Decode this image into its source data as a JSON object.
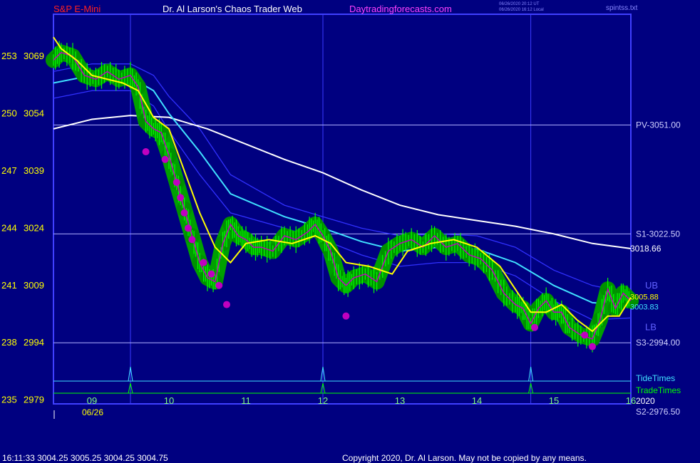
{
  "header": {
    "instrument": "S&P E-Mini",
    "title": "Dr. Al Larson's Chaos Trader Web",
    "site": "Daytradingforecasts.com",
    "stamp_ut": "06/26/2020 20:12 UT",
    "stamp_local": "06/26/2020 16:12 Local",
    "file": "spintss.txt"
  },
  "footer": {
    "quote": "16:11:33  3004.25 3005.25 3004.25 3004.75",
    "copyright": "Copyright 2020, Dr. Al Larson. May not be copied by any means."
  },
  "colors": {
    "background": "#000080",
    "frame": "#4040ff",
    "price_fill": "#00a000",
    "price_bar": "#00ff00",
    "magenta": "#c000c0",
    "yellow": "#ffff00",
    "cyan": "#40e0ff",
    "white": "#ffffff",
    "blue_band": "#3030ff",
    "red_text": "#ff2020",
    "magenta_text": "#ff40ff"
  },
  "chart_data": {
    "type": "line",
    "date_label": "06/26",
    "year_label": "2020",
    "xlim": [
      8.5,
      16.0
    ],
    "ylim": [
      2978,
      3080
    ],
    "x_ticks": [
      {
        "x": 9,
        "label": "09"
      },
      {
        "x": 10,
        "label": "10"
      },
      {
        "x": 11,
        "label": "11"
      },
      {
        "x": 12,
        "label": "12"
      },
      {
        "x": 13,
        "label": "13"
      },
      {
        "x": 14,
        "label": "14"
      },
      {
        "x": 15,
        "label": "15"
      },
      {
        "x": 16,
        "label": "16"
      }
    ],
    "y_ticks": [
      {
        "y": 3069,
        "left": "253",
        "right": "3069"
      },
      {
        "y": 3054,
        "left": "250",
        "right": "3054"
      },
      {
        "y": 3039,
        "left": "247",
        "right": "3039"
      },
      {
        "y": 3024,
        "left": "244",
        "right": "3024"
      },
      {
        "y": 3009,
        "left": "241",
        "right": "3009"
      },
      {
        "y": 2994,
        "left": "238",
        "right": "2994"
      },
      {
        "y": 2979,
        "left": "235",
        "right": "2979"
      }
    ],
    "levels": [
      {
        "label": "PV-3051.00",
        "value": 3051.0
      },
      {
        "label": "S1-3022.50",
        "value": 3022.5
      },
      {
        "label": "S3-2994.00",
        "value": 2994.0
      },
      {
        "label": "S2-2976.50",
        "value": 2976.5
      }
    ],
    "tide_times": {
      "label": "TideTimes",
      "x": [
        9.5,
        12.0,
        14.7
      ]
    },
    "trade_times": {
      "label": "TradeTimes",
      "x": [
        9.5,
        12.0,
        14.7
      ]
    },
    "band_labels": {
      "upper": "UB",
      "lower": "LB"
    },
    "end_labels": {
      "white": "3018.66",
      "yellow": "3005.88",
      "cyan": "3003.83"
    },
    "series": [
      {
        "x": [
          8.5,
          9.0,
          9.5,
          10.0,
          10.5,
          11.0,
          11.5,
          12.0,
          12.5,
          13.0,
          13.5,
          14.0,
          14.5,
          15.0,
          15.5,
          16.0
        ],
        "y": [
          3050.0,
          3052.5,
          3053.5,
          3053.0,
          3050.0,
          3046.0,
          3042.0,
          3038.5,
          3034.0,
          3030.0,
          3027.5,
          3026.0,
          3024.5,
          3022.5,
          3020.0,
          3018.66
        ]
      },
      {
        "x": [
          8.5,
          9.0,
          9.5,
          9.8,
          10.0,
          10.4,
          10.8,
          11.5,
          12.0,
          12.5,
          13.0,
          13.5,
          14.0,
          14.5,
          15.0,
          15.5,
          16.0
        ],
        "y": [
          3062.0,
          3064.0,
          3063.5,
          3060.0,
          3054.0,
          3044.0,
          3033.0,
          3027.0,
          3024.0,
          3020.5,
          3018.0,
          3019.0,
          3018.5,
          3015.0,
          3009.0,
          3004.5,
          3003.83
        ]
      },
      {
        "x": [
          8.5,
          9.0,
          9.5,
          9.8,
          10.0,
          10.4,
          10.8,
          11.5,
          12.0,
          12.5,
          13.0,
          13.5,
          14.0,
          14.5,
          15.0,
          15.5,
          16.0
        ],
        "y": [
          3065.0,
          3067.0,
          3067.0,
          3064.0,
          3058.5,
          3050.0,
          3038.0,
          3030.0,
          3027.0,
          3024.0,
          3022.0,
          3022.5,
          3022.0,
          3019.0,
          3013.0,
          3009.0,
          3007.0
        ]
      },
      {
        "x": [
          8.5,
          9.0,
          9.5,
          9.8,
          10.0,
          10.4,
          10.8,
          11.5,
          12.0,
          12.5,
          13.0,
          13.5,
          14.0,
          14.5,
          15.0,
          15.5,
          16.0
        ],
        "y": [
          3058.0,
          3060.0,
          3060.0,
          3056.0,
          3049.5,
          3038.0,
          3028.0,
          3024.0,
          3021.0,
          3017.0,
          3014.0,
          3015.0,
          3015.0,
          3011.5,
          3005.0,
          3000.0,
          3000.5
        ]
      },
      {
        "x": [
          8.5,
          8.6,
          8.8,
          9.0,
          9.2,
          9.4,
          9.6,
          9.8,
          10.0,
          10.2,
          10.4,
          10.6,
          10.8,
          11.0,
          11.3,
          11.6,
          11.9,
          12.1,
          12.3,
          12.6,
          12.9,
          13.1,
          13.4,
          13.7,
          14.0,
          14.3,
          14.5,
          14.7,
          14.9,
          15.1,
          15.3,
          15.5,
          15.7,
          15.85,
          16.0
        ],
        "y": [
          3074.0,
          3071.0,
          3068.0,
          3064.0,
          3063.0,
          3062.0,
          3060.0,
          3053.0,
          3050.0,
          3039.0,
          3028.0,
          3019.0,
          3015.0,
          3020.0,
          3021.0,
          3020.0,
          3022.0,
          3020.0,
          3015.0,
          3014.0,
          3012.0,
          3018.0,
          3020.0,
          3021.0,
          3019.0,
          3014.0,
          3008.0,
          3002.0,
          3002.0,
          3004.0,
          3000.0,
          2997.0,
          3001.0,
          3001.0,
          3005.88
        ]
      }
    ],
    "price_path": {
      "x": [
        8.5,
        8.6,
        8.75,
        8.9,
        9.05,
        9.2,
        9.35,
        9.5,
        9.6,
        9.7,
        9.8,
        9.9,
        10.0,
        10.1,
        10.2,
        10.3,
        10.4,
        10.5,
        10.6,
        10.7,
        10.8,
        10.9,
        11.0,
        11.1,
        11.2,
        11.35,
        11.5,
        11.65,
        11.8,
        11.9,
        12.0,
        12.1,
        12.2,
        12.3,
        12.4,
        12.55,
        12.7,
        12.85,
        13.0,
        13.15,
        13.3,
        13.45,
        13.6,
        13.75,
        13.9,
        14.05,
        14.2,
        14.35,
        14.5,
        14.6,
        14.7,
        14.8,
        14.9,
        15.0,
        15.1,
        15.2,
        15.35,
        15.5,
        15.6,
        15.7,
        15.8,
        15.9,
        16.0
      ],
      "y": [
        3068,
        3070,
        3069,
        3064,
        3063,
        3065,
        3063,
        3064,
        3061,
        3052,
        3050,
        3049,
        3043,
        3036,
        3029,
        3022,
        3015,
        3011,
        3010,
        3020,
        3025,
        3022,
        3021,
        3019,
        3019,
        3018,
        3022,
        3021,
        3023,
        3025,
        3022,
        3018,
        3011,
        3009,
        3011,
        3012,
        3010,
        3018,
        3020,
        3021,
        3019,
        3022,
        3019,
        3020,
        3017,
        3016,
        3013,
        3007,
        3004,
        3003,
        2999,
        3003,
        3005,
        3002,
        3002,
        2998,
        2996,
        2995,
        3000,
        3008,
        3003,
        3007,
        3005
      ]
    },
    "magenta_dots": {
      "x": [
        9.7,
        9.95,
        10.1,
        10.15,
        10.2,
        10.25,
        10.3,
        10.45,
        10.55,
        10.65,
        10.75,
        12.3,
        14.75,
        15.4,
        15.5
      ],
      "y": [
        3044,
        3042,
        3036,
        3032,
        3028,
        3024,
        3021,
        3015,
        3012,
        3009,
        3004,
        3001,
        2998,
        2996,
        2993
      ]
    }
  }
}
